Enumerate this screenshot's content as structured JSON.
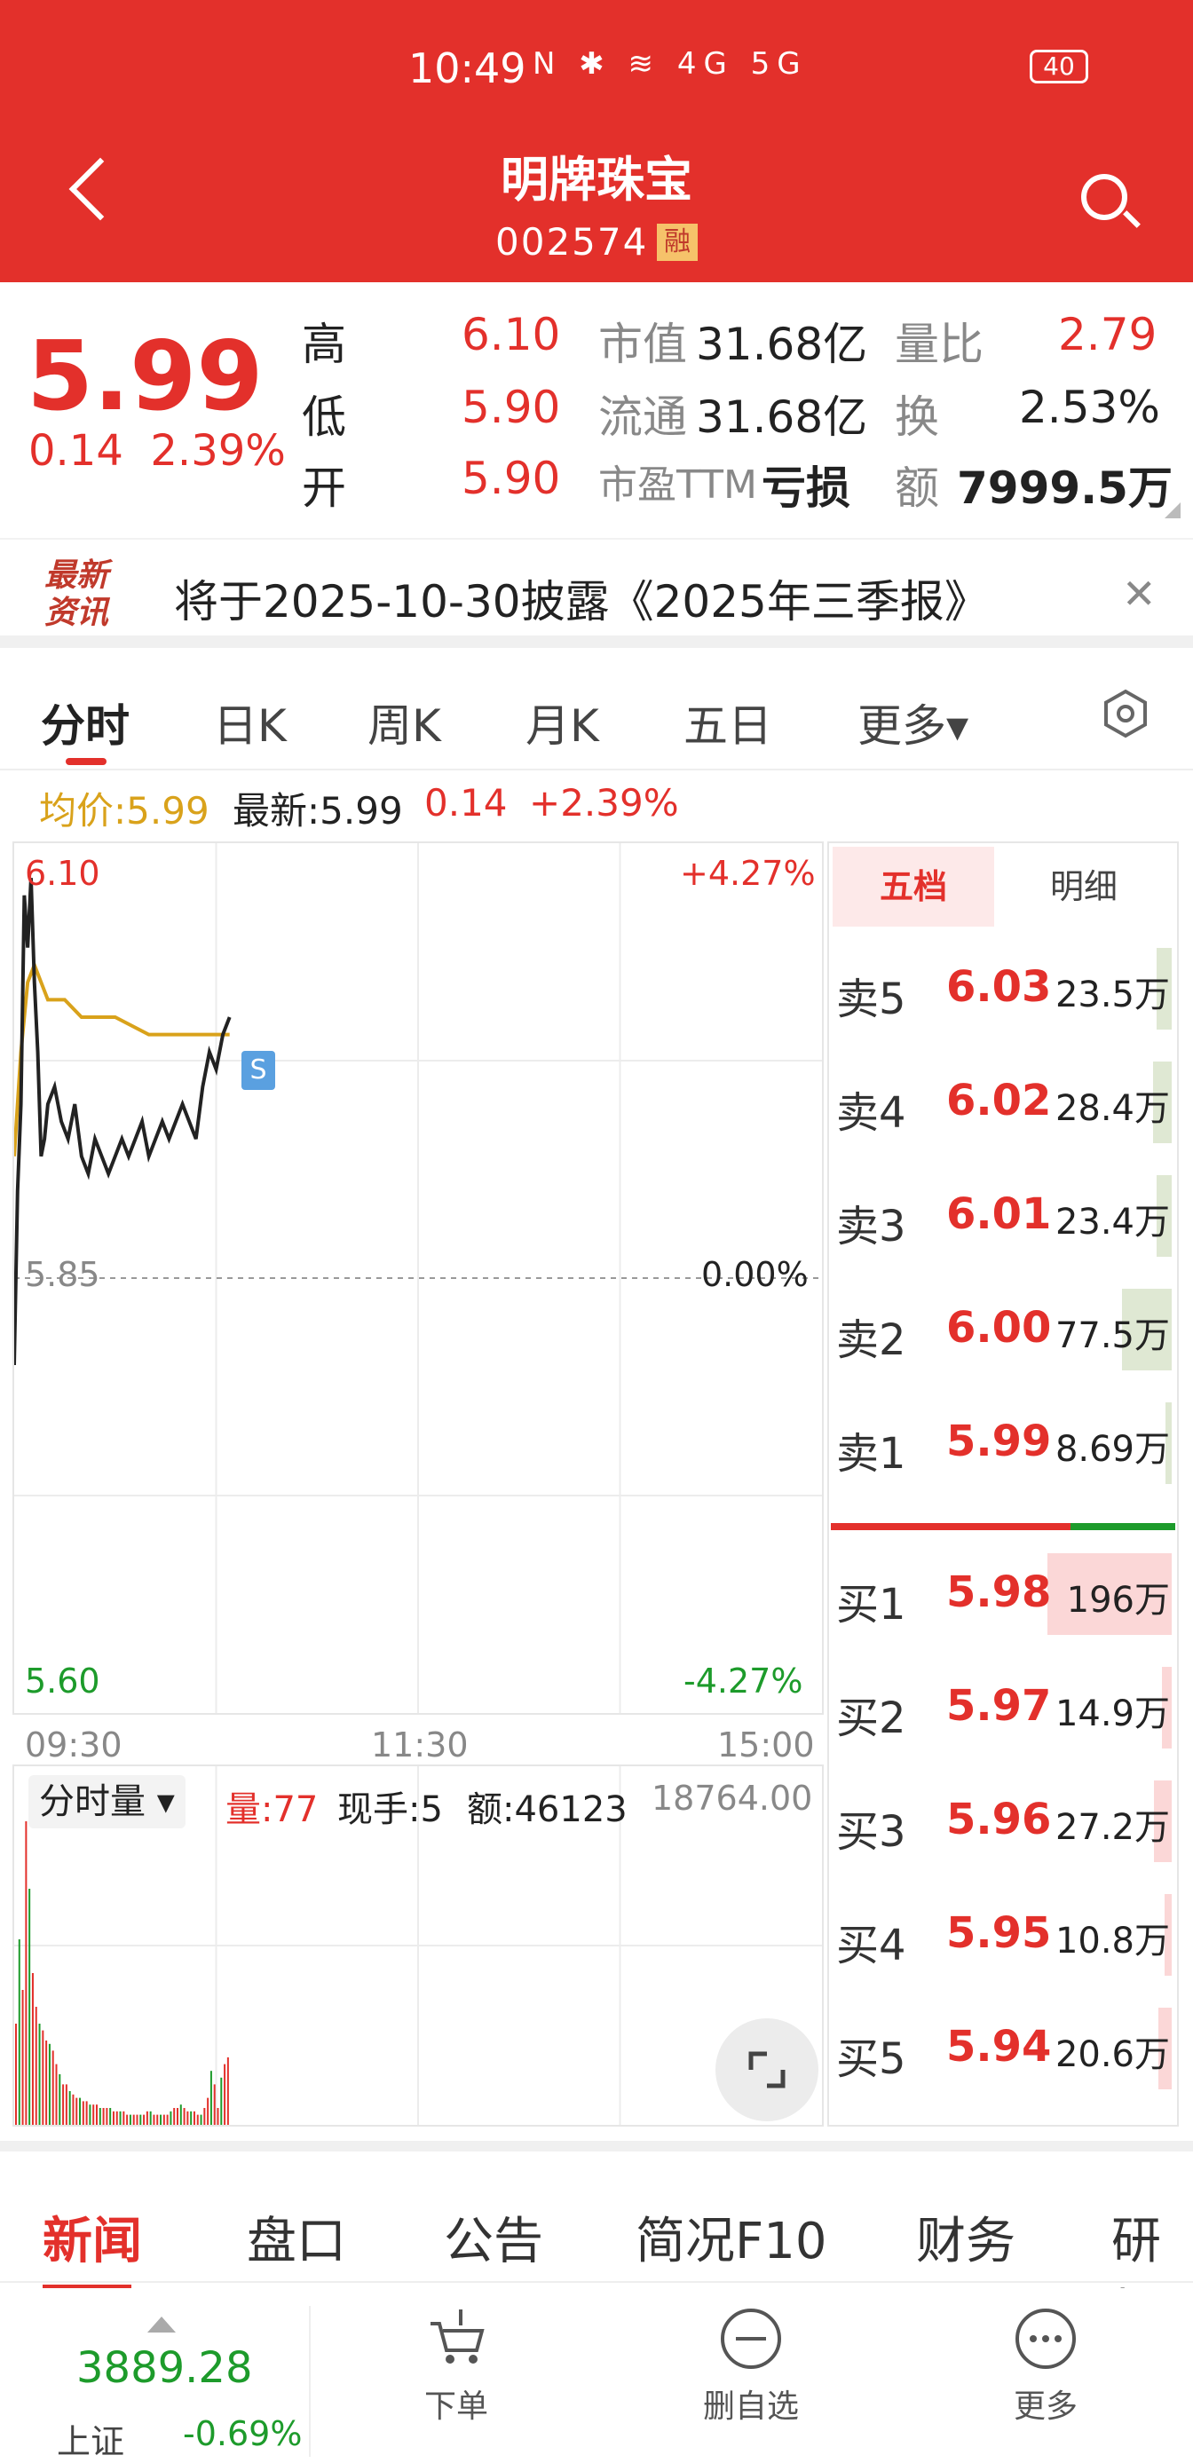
{
  "status_bar": {
    "time": "10:49",
    "icons": "N ✱ ≋ 4G 5G",
    "battery": "40"
  },
  "header": {
    "title": "明牌珠宝",
    "code": "002574",
    "badge": "融"
  },
  "quote": {
    "price": "5.99",
    "change": "0.14",
    "change_pct": "2.39%",
    "high_label": "高",
    "high": "6.10",
    "low_label": "低",
    "low": "5.90",
    "open_label": "开",
    "open": "5.90",
    "mcap_label": "市值",
    "mcap": "31.68亿",
    "float_label": "流通",
    "float": "31.68亿",
    "pe_label": "市盈TTM",
    "pe": "亏损",
    "vol_ratio_label": "量比",
    "vol_ratio": "2.79",
    "turnover_label": "换",
    "turnover": "2.53%",
    "amount_label": "额",
    "amount": "7999.5万"
  },
  "news": {
    "logo_line1": "最新",
    "logo_line2": "资讯",
    "text": "将于2025-10-30披露《2025年三季报》"
  },
  "tabs": [
    "分时",
    "日K",
    "周K",
    "月K",
    "五日",
    "更多▾"
  ],
  "legend": {
    "avg": "均价:5.99",
    "latest": "最新:5.99",
    "chg": "0.14",
    "pct": "+2.39%"
  },
  "chart_axes": {
    "ymax": "6.10",
    "ymid": "5.85",
    "ymin": "5.60",
    "pct_max": "+4.27%",
    "pct_mid": "0.00%",
    "pct_min": "-4.27%",
    "t_start": "09:30",
    "t_mid": "11:30",
    "t_end": "15:00",
    "signal": "S"
  },
  "volume": {
    "selector": "分时量 ▾",
    "vol": "量:77",
    "hand": "现手:5",
    "amount": "额:46123",
    "max": "18764.00"
  },
  "chart_data": {
    "type": "line",
    "x_unit": "minutes since 09:30",
    "ylim": [
      5.6,
      6.1
    ],
    "series": [
      {
        "name": "最新",
        "x": [
          0,
          1,
          2,
          3,
          4,
          5,
          6,
          7,
          8,
          9,
          10,
          12,
          14,
          16,
          18,
          20,
          22,
          24,
          26,
          28,
          30,
          32,
          34,
          36,
          38,
          40,
          42,
          44,
          46,
          48,
          50,
          52,
          54,
          56,
          58,
          60,
          62,
          64
        ],
        "values": [
          5.8,
          5.9,
          5.95,
          6.07,
          6.04,
          6.08,
          6.02,
          5.98,
          5.92,
          5.93,
          5.95,
          5.96,
          5.94,
          5.93,
          5.95,
          5.92,
          5.91,
          5.93,
          5.92,
          5.91,
          5.92,
          5.93,
          5.92,
          5.93,
          5.94,
          5.92,
          5.93,
          5.94,
          5.93,
          5.94,
          5.95,
          5.94,
          5.93,
          5.96,
          5.98,
          5.97,
          5.99,
          6.0
        ]
      },
      {
        "name": "均价",
        "x": [
          0,
          2,
          4,
          6,
          8,
          10,
          15,
          20,
          30,
          40,
          50,
          60,
          64
        ],
        "values": [
          5.92,
          5.98,
          6.02,
          6.03,
          6.02,
          6.01,
          6.01,
          6.0,
          6.0,
          5.99,
          5.99,
          5.99,
          5.99
        ]
      }
    ],
    "volume_bars": [
      30,
      55,
      40,
      90,
      70,
      45,
      35,
      30,
      28,
      25,
      24,
      22,
      18,
      15,
      12,
      12,
      10,
      9,
      8,
      8,
      7,
      7,
      6,
      6,
      6,
      5,
      5,
      5,
      5,
      4,
      4,
      4,
      4,
      3,
      3,
      3,
      3,
      3,
      3,
      4,
      4,
      3,
      3,
      3,
      3,
      3,
      4,
      5,
      5,
      6,
      5,
      4,
      4,
      4,
      3,
      3,
      5,
      8,
      16,
      12,
      5,
      14,
      18,
      20
    ]
  },
  "order_book": {
    "tabs": [
      "五档",
      "明细"
    ],
    "asks": [
      {
        "label": "卖5",
        "price": "6.03",
        "vol": "23.5万",
        "share": 0.12
      },
      {
        "label": "卖4",
        "price": "6.02",
        "vol": "28.4万",
        "share": 0.15
      },
      {
        "label": "卖3",
        "price": "6.01",
        "vol": "23.4万",
        "share": 0.12
      },
      {
        "label": "卖2",
        "price": "6.00",
        "vol": "77.5万",
        "share": 0.4
      },
      {
        "label": "卖1",
        "price": "5.99",
        "vol": "8.69万",
        "share": 0.05
      }
    ],
    "bids": [
      {
        "label": "买1",
        "price": "5.98",
        "vol": "196万",
        "share": 1.0
      },
      {
        "label": "买2",
        "price": "5.97",
        "vol": "14.9万",
        "share": 0.08
      },
      {
        "label": "买3",
        "price": "5.96",
        "vol": "27.2万",
        "share": 0.14
      },
      {
        "label": "买4",
        "price": "5.95",
        "vol": "10.8万",
        "share": 0.06
      },
      {
        "label": "买5",
        "price": "5.94",
        "vol": "20.6万",
        "share": 0.11
      }
    ]
  },
  "bottom_tabs": [
    "新闻",
    "盘口",
    "公告",
    "简况F10",
    "财务",
    "研报"
  ],
  "footer": {
    "index_value": "3889.28",
    "index_name": "上证",
    "index_chg": "-0.69%",
    "buttons": [
      "下单",
      "删自选",
      "更多"
    ]
  },
  "colors": {
    "red": "#e3302b",
    "green": "#1d9b2b",
    "avg_line": "#d9a21b"
  }
}
